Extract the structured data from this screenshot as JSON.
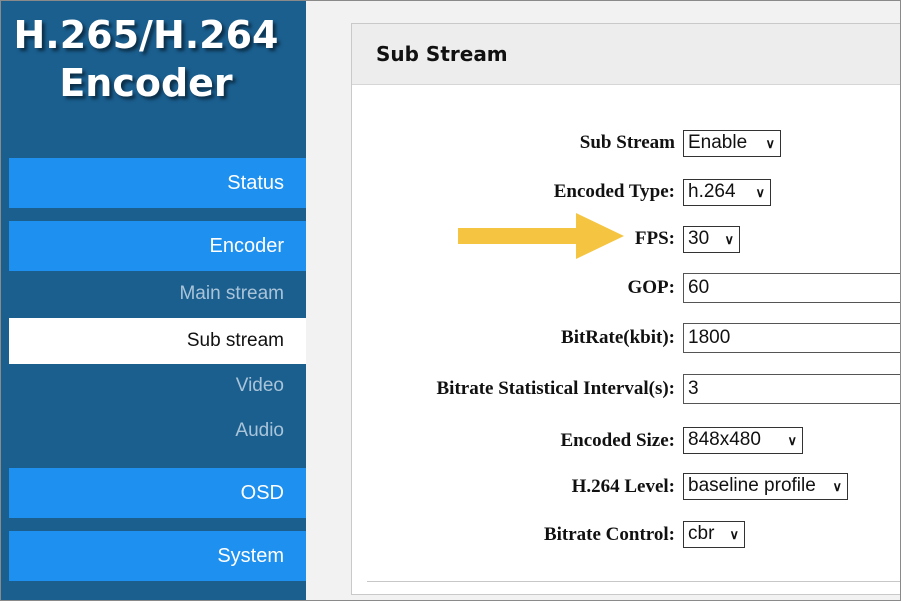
{
  "app": {
    "title_line1": "H.265/H.264",
    "title_line2": "Encoder"
  },
  "sidebar": {
    "items": [
      {
        "label": "Status",
        "kind": "main"
      },
      {
        "label": "Encoder",
        "kind": "main"
      },
      {
        "label": "Main stream",
        "kind": "sub"
      },
      {
        "label": "Sub stream",
        "kind": "active"
      },
      {
        "label": "Video",
        "kind": "sub"
      },
      {
        "label": "Audio",
        "kind": "sub"
      },
      {
        "label": "OSD",
        "kind": "main"
      },
      {
        "label": "System",
        "kind": "main"
      }
    ]
  },
  "panel": {
    "title": "Sub Stream"
  },
  "form": {
    "sub_stream": {
      "label": "Sub Stream",
      "value": "Enable"
    },
    "encoded_type": {
      "label": "Encoded Type:",
      "value": "h.264"
    },
    "fps": {
      "label": "FPS:",
      "value": "30"
    },
    "gop": {
      "label": "GOP:",
      "value": "60"
    },
    "bitrate": {
      "label": "BitRate(kbit):",
      "value": "1800"
    },
    "interval": {
      "label": "Bitrate Statistical Interval(s):",
      "value": "3"
    },
    "encoded_size": {
      "label": "Encoded Size:",
      "value": "848x480"
    },
    "level": {
      "label": "H.264 Level:",
      "value": "baseline profile"
    },
    "bitrate_control": {
      "label": "Bitrate Control:",
      "value": "cbr"
    }
  },
  "icons": {
    "dropdown": "chevron-down-icon",
    "annotation": "arrow-right-icon"
  },
  "colors": {
    "sidebar_bg": "#1b5f8f",
    "nav_button": "#1e90f0",
    "arrow": "#f5c542"
  }
}
